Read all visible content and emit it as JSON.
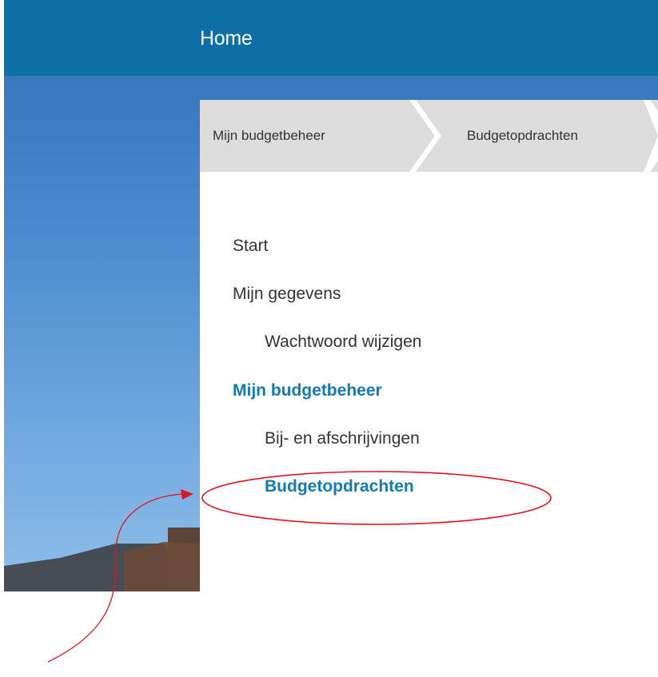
{
  "header": {
    "title": "Home"
  },
  "breadcrumb": {
    "items": [
      "Mijn budgetbeheer",
      "Budgetopdrachten"
    ]
  },
  "nav": {
    "start": "Start",
    "mijn_gegevens": "Mijn gegevens",
    "wachtwoord_wijzigen": "Wachtwoord wijzigen",
    "mijn_budgetbeheer": "Mijn budgetbeheer",
    "bij_en_afschrijvingen": "Bij- en afschrijvingen",
    "budgetopdrachten": "Budgetopdrachten"
  },
  "colors": {
    "header_bg": "#0e6ea6",
    "active_link": "#137bb0",
    "breadcrumb_bg": "#dcdcdc",
    "annotation": "#e0141e"
  }
}
